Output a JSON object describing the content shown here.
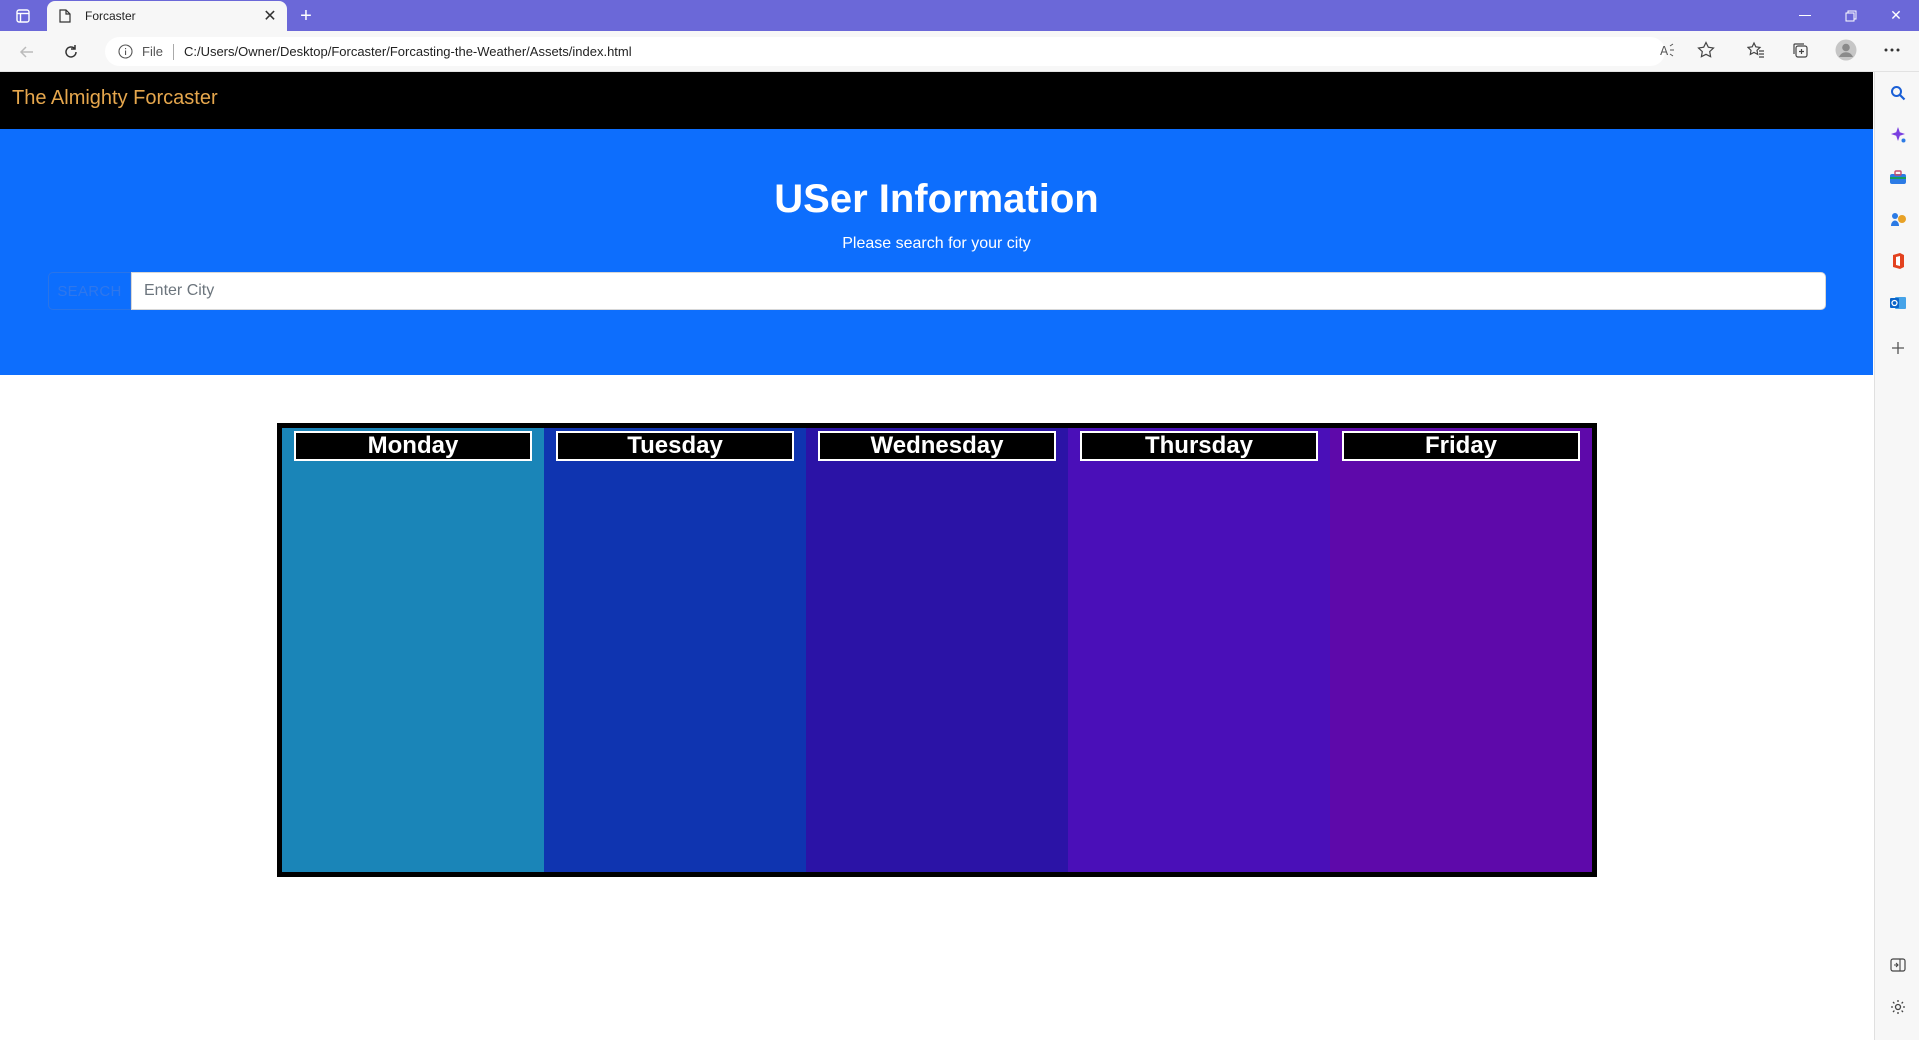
{
  "browser": {
    "tab_title": "Forcaster",
    "url_protocol": "File",
    "url_path": "C:/Users/Owner/Desktop/Forcaster/Forcasting-the-Weather/Assets/index.html",
    "frame_color": "#6b68d8"
  },
  "navbar": {
    "brand": "The Almighty Forcaster",
    "brand_color": "#e6a74d"
  },
  "hero": {
    "title": "USer Information",
    "subtitle": "Please search for your city",
    "search_button": "SEARCH",
    "search_placeholder": "Enter City",
    "background": "#0d6efd"
  },
  "forecast": {
    "days": [
      {
        "label": "Monday",
        "color": "#1a85b8"
      },
      {
        "label": "Tuesday",
        "color": "#0f34b0"
      },
      {
        "label": "Wednesday",
        "color": "#2b13a6"
      },
      {
        "label": "Thursday",
        "color": "#4a0fb8"
      },
      {
        "label": "Friday",
        "color": "#5e09aa"
      }
    ]
  },
  "icons": {
    "edge_sidebar": [
      "search-icon",
      "copilot-icon",
      "tools-icon",
      "games-icon",
      "office-icon",
      "outlook-icon",
      "add-icon",
      "sidebar-toggle-icon",
      "settings-icon"
    ]
  }
}
